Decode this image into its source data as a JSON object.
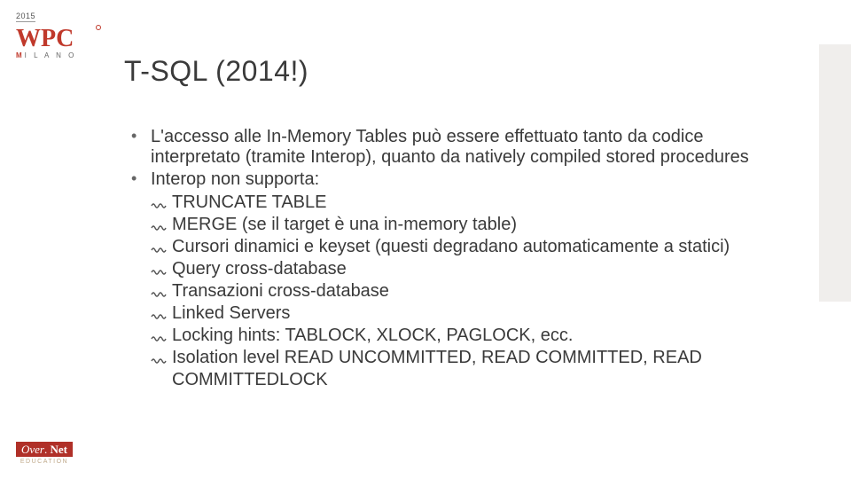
{
  "logo": {
    "year": "2015",
    "brand": "WPC",
    "sub_accent": "M",
    "sub_rest": "I L A N O"
  },
  "title": "T-SQL (2014!)",
  "bullets": [
    "L'accesso alle In-Memory Tables può essere effettuato tanto da codice interpretato (tramite Interop), quanto da natively compiled stored procedures",
    "Interop non supporta:"
  ],
  "subitems": [
    "TRUNCATE TABLE",
    "MERGE (se il target è una in-memory table)",
    "Cursori dinamici e keyset (questi degradano automaticamente a statici)",
    "Query cross-database",
    "Transazioni cross-database",
    "Linked Servers",
    "Locking hints: TABLOCK, XLOCK, PAGLOCK, ecc.",
    "Isolation level READ UNCOMMITTED, READ COMMITTED, READ COMMITTEDLOCK"
  ],
  "footer": {
    "brand_thin": "Over",
    "brand_bold": "Net",
    "sub": "EDUCATION"
  }
}
